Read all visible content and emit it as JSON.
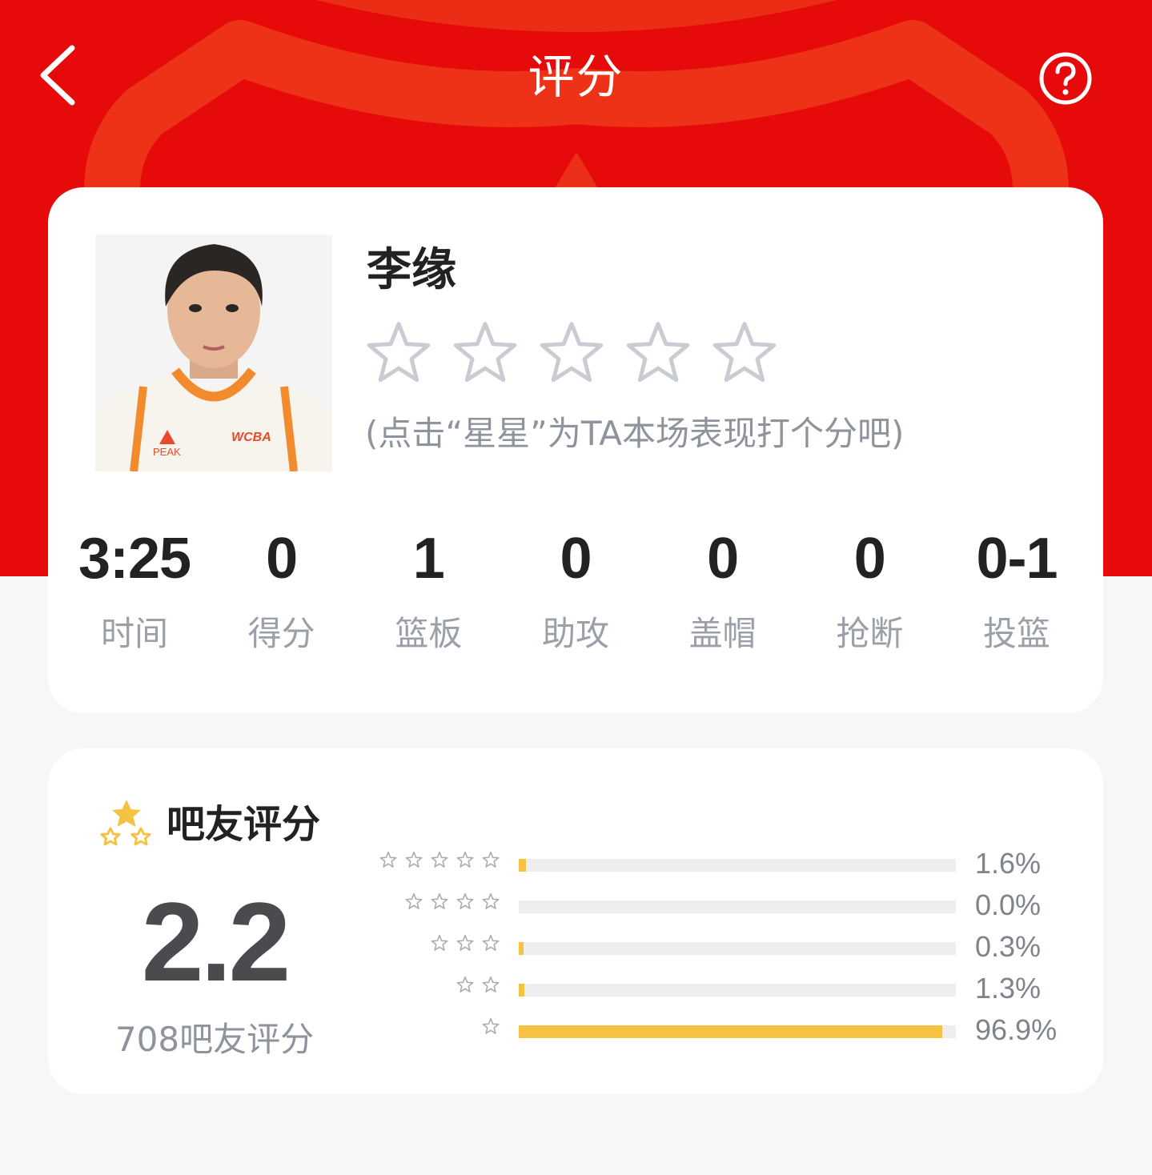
{
  "header": {
    "title": "评分"
  },
  "player": {
    "name": "李缘",
    "rating_stars_max": 5,
    "rating_stars_selected": 0,
    "rate_hint": "(点击“星星”为TA本场表现打个分吧)",
    "jersey": {
      "brand_mark": "PEAK",
      "league_mark": "WCBA"
    }
  },
  "stats": [
    {
      "value": "3:25",
      "label": "时间"
    },
    {
      "value": "0",
      "label": "得分"
    },
    {
      "value": "1",
      "label": "篮板"
    },
    {
      "value": "0",
      "label": "助攻"
    },
    {
      "value": "0",
      "label": "盖帽"
    },
    {
      "value": "0",
      "label": "抢断"
    },
    {
      "value": "0-1",
      "label": "投篮"
    }
  ],
  "fans": {
    "title": "吧友评分",
    "score": "2.2",
    "count_text": "708吧友评分",
    "distribution": [
      {
        "stars": 5,
        "percent": 1.6,
        "percent_text": "1.6%"
      },
      {
        "stars": 4,
        "percent": 0.0,
        "percent_text": "0.0%"
      },
      {
        "stars": 3,
        "percent": 0.3,
        "percent_text": "0.3%"
      },
      {
        "stars": 2,
        "percent": 1.3,
        "percent_text": "1.3%"
      },
      {
        "stars": 1,
        "percent": 96.9,
        "percent_text": "96.9%"
      }
    ]
  },
  "colors": {
    "header_red": "#e60a0a",
    "bar_gold": "#f6c242",
    "star_outline": "#c9ccd2"
  },
  "icons": {
    "back": "chevron-left-icon",
    "help": "question-circle-icon",
    "rating": "star-outline-icon",
    "fans": "three-stars-icon"
  }
}
